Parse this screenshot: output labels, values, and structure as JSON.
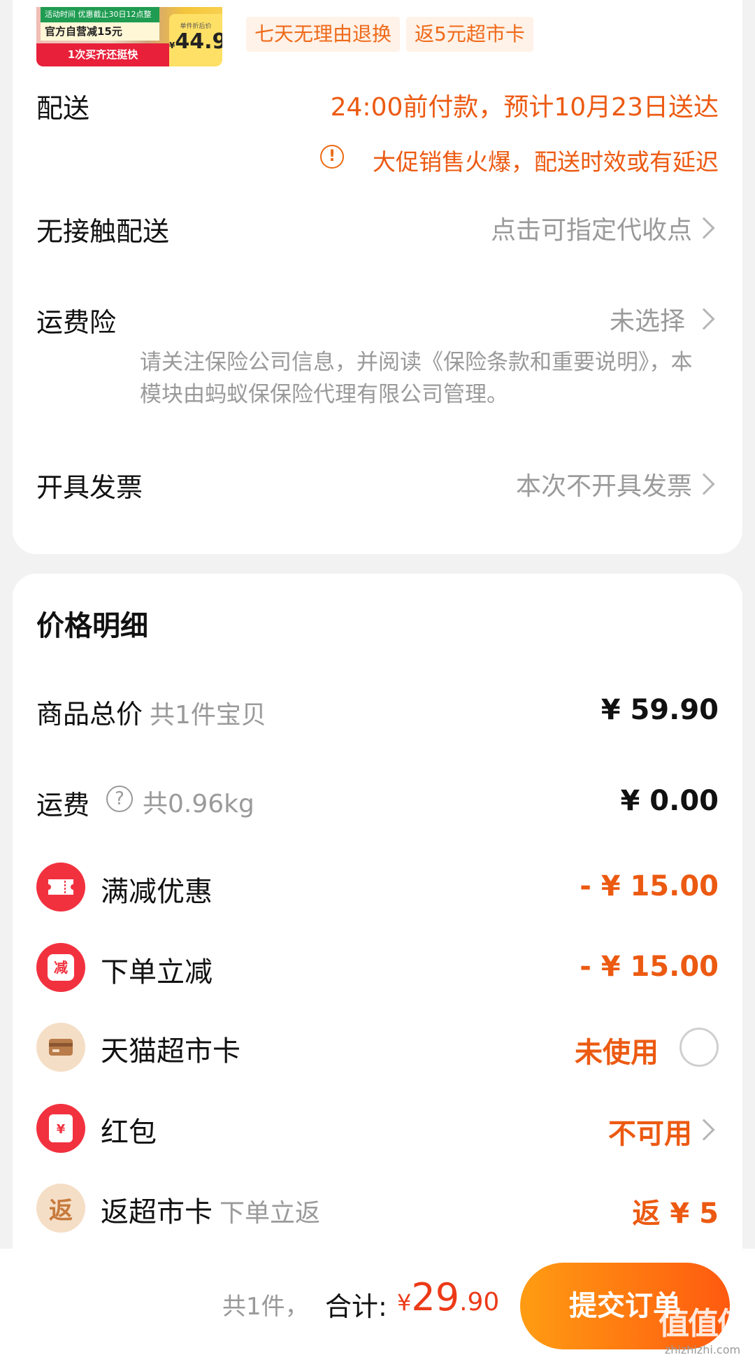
{
  "product": {
    "thumb_tag_top": "活动时间 优惠截止30日12点整",
    "thumb_tag_mid": "官方自营减15元",
    "thumb_tag_bottom": "1次买齐还挺快",
    "thumb_price_label": "单件折后价",
    "thumb_price_symbol": "¥",
    "thumb_price": "44.9",
    "pill_return": "七天无理由退换",
    "pill_card": "返5元超市卡"
  },
  "delivery": {
    "label": "配送",
    "value": "24:00前付款，预计10月23日送达",
    "warning_icon": "!",
    "warning": "大促销售火爆，配送时效或有延迟"
  },
  "contactless": {
    "label": "无接触配送",
    "value": "点击可指定代收点"
  },
  "insurance": {
    "label": "运费险",
    "value": "未选择",
    "note": "请关注保险公司信息，并阅读《保险条款和重要说明》，本模块由蚂蚁保保险代理有限公司管理。"
  },
  "invoice": {
    "label": "开具发票",
    "value": "本次不开具发票"
  },
  "price_detail": {
    "title": "价格明细",
    "goods_total_label": "商品总价",
    "goods_total_sub": "共1件宝贝",
    "goods_total_value": "¥ 59.90",
    "shipping_label": "运费",
    "shipping_help_icon": "?",
    "shipping_sub": "共0.96kg",
    "shipping_value": "¥ 0.00",
    "full_reduction_label": "满减优惠",
    "full_reduction_value": "- ¥ 15.00",
    "order_reduction_icon_text": "减",
    "order_reduction_label": "下单立减",
    "order_reduction_value": "- ¥ 15.00",
    "tmall_card_label": "天猫超市卡",
    "tmall_card_value": "未使用",
    "red_packet_icon_text": "¥",
    "red_packet_label": "红包",
    "red_packet_value": "不可用",
    "rebate_icon_text": "返",
    "rebate_label": "返超市卡",
    "rebate_sub": "下单立返",
    "rebate_value": "返 ¥ 5"
  },
  "bottom_bar": {
    "count": "共1件，",
    "total_label": "合计:",
    "total_symbol": "¥",
    "total_int": "29",
    "total_dec": ".90",
    "submit": "提交订单"
  },
  "watermark": {
    "text": "值值值",
    "url": "zhizhizhi.com"
  },
  "colors": {
    "accent": "#ec5a12",
    "price_red": "#ec3a18",
    "icon_red": "#f2313f",
    "button_start": "#ff9c12",
    "button_end": "#ff5a10"
  },
  "icons": [
    "coupon-icon",
    "reduce-icon",
    "card-icon",
    "red-packet-icon",
    "rebate-icon",
    "chevron-right-icon",
    "warning-icon",
    "help-icon",
    "radio-unchecked-icon"
  ]
}
